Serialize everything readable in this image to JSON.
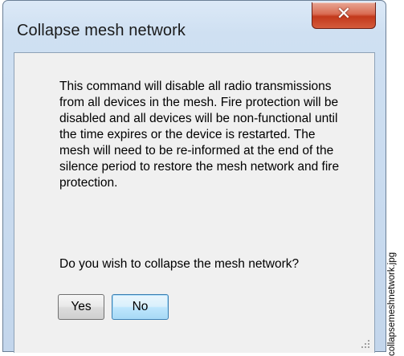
{
  "window": {
    "title": "Collapse mesh network",
    "close_glyph": "✕"
  },
  "dialog": {
    "message": "This command will disable all radio transmissions from all devices in the mesh. Fire protection will be disabled and all devices will be non-functional until the time expires or the device is restarted. The mesh will need to be re-informed at the end of the silence period to restore the mesh network and fire protection.",
    "question": "Do you wish to collapse the mesh network?",
    "yes_label": "Yes",
    "no_label": "No",
    "default_button": "No"
  },
  "figure": {
    "side_label": "collapsemeshnetwork.jpg"
  },
  "colors": {
    "close_button": "#c3391c",
    "window_frame": "#cfe0f2",
    "client_background": "#f0f0f0",
    "default_button_border": "#3c7fb1"
  }
}
